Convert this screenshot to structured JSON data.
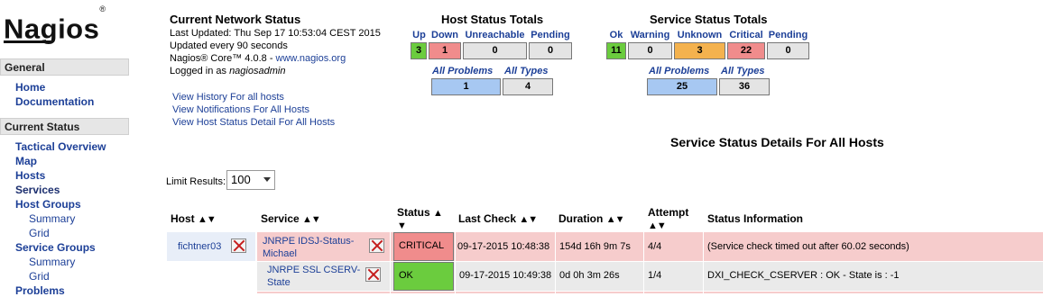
{
  "sidebar": {
    "logo": "Nagios",
    "logo_mark": "®",
    "sections": [
      {
        "title": "General",
        "items": [
          {
            "label": "Home"
          },
          {
            "label": "Documentation"
          }
        ]
      },
      {
        "title": "Current Status",
        "items": [
          {
            "label": "Tactical Overview"
          },
          {
            "label": "Map"
          },
          {
            "label": "Hosts"
          },
          {
            "label": "Services"
          },
          {
            "label": "Host Groups"
          },
          {
            "label": "Summary"
          },
          {
            "label": "Grid"
          },
          {
            "label": "Service Groups"
          },
          {
            "label": "Summary"
          },
          {
            "label": "Grid"
          },
          {
            "label": "Problems"
          }
        ]
      }
    ]
  },
  "info": {
    "title": "Current Network Status",
    "last_updated": "Last Updated: Thu Sep 17 10:53:04 CEST 2015",
    "update_interval": "Updated every 90 seconds",
    "version_prefix": "Nagios® Core™ 4.0.8 - ",
    "version_link": "www.nagios.org",
    "logged_in_prefix": "Logged in as ",
    "user": "nagiosadmin",
    "links": [
      "View History For all hosts",
      "View Notifications For All Hosts",
      "View Host Status Detail For All Hosts"
    ]
  },
  "host_totals": {
    "title": "Host Status Totals",
    "headers": [
      "Up",
      "Down",
      "Unreachable",
      "Pending"
    ],
    "values": [
      "3",
      "1",
      "0",
      "0"
    ],
    "problems_labels": [
      "All Problems",
      "All Types"
    ],
    "problems_values": [
      "1",
      "4"
    ]
  },
  "service_totals": {
    "title": "Service Status Totals",
    "headers": [
      "Ok",
      "Warning",
      "Unknown",
      "Critical",
      "Pending"
    ],
    "values": [
      "11",
      "0",
      "3",
      "22",
      "0"
    ],
    "problems_labels": [
      "All Problems",
      "All Types"
    ],
    "problems_values": [
      "25",
      "36"
    ]
  },
  "page_title": "Service Status Details For All Hosts",
  "limit": {
    "label": "Limit Results:",
    "value": "100"
  },
  "table": {
    "columns": [
      "Host",
      "Service",
      "Status",
      "Last Check",
      "Duration",
      "Attempt",
      "Status Information"
    ],
    "rows": [
      {
        "host": "fichtner03",
        "service_line1": "JNRPE IDSJ-Status-",
        "service_line2": "Michael",
        "status": "CRITICAL",
        "last_check": "09-17-2015 10:48:38",
        "duration": "154d 16h 9m 7s",
        "attempt": "4/4",
        "info": "(Service check timed out after 60.02 seconds)"
      },
      {
        "host": "",
        "service_line1": "JNRPE SSL CSERV-",
        "service_line2": "State",
        "status": "OK",
        "last_check": "09-17-2015 10:49:38",
        "duration": "0d 0h 3m 26s",
        "attempt": "1/4",
        "info": "DXI_CHECK_CSERVER : OK - State is : -1"
      }
    ]
  },
  "colors": {
    "ok": "#6bcc3e",
    "critical": "#f08c8c",
    "unknown": "#f4b24e",
    "problems": "#a7c8f2",
    "link": "#1c3f97"
  }
}
